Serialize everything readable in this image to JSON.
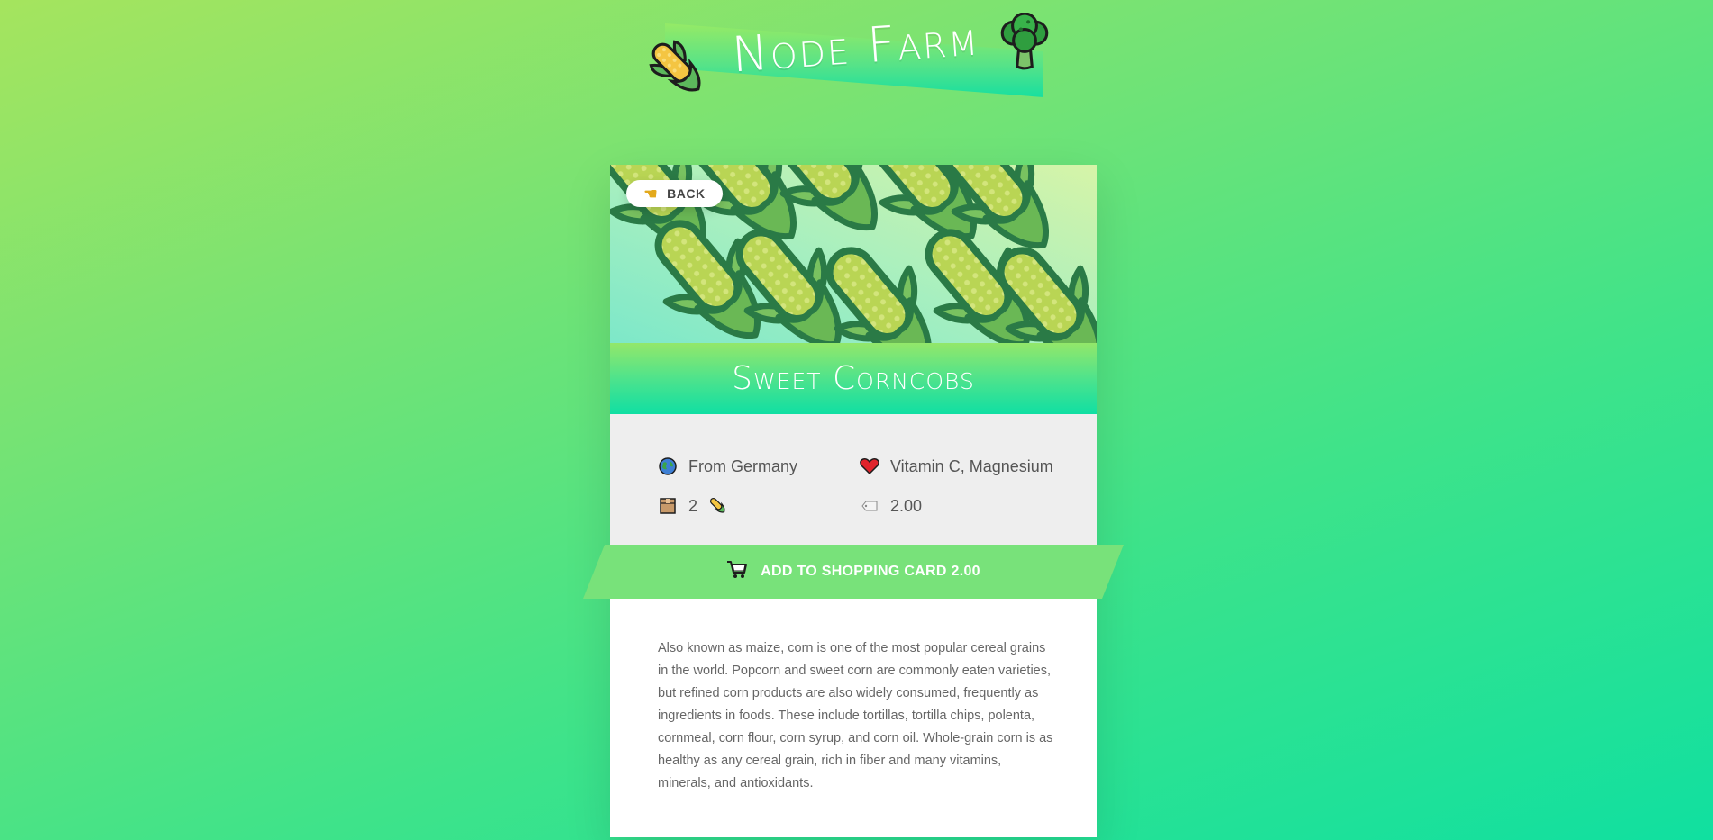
{
  "header": {
    "title": "Node Farm",
    "left_icon": "corn-icon",
    "right_icon": "broccoli-icon"
  },
  "product": {
    "back_label": "BACK",
    "back_icon": "pointing-hand-icon",
    "name": "Sweet Corncobs",
    "origin": "From Germany",
    "origin_icon": "globe-icon",
    "nutrients": "Vitamin C, Magnesium",
    "nutrients_icon": "heart-icon",
    "quantity": "2",
    "quantity_icon": "box-icon",
    "quantity_unit_icon": "corn-icon",
    "price": "2.00",
    "price_icon": "price-tag-icon",
    "add_to_cart_label": "ADD TO SHOPPING CARD 2.00",
    "cart_icon": "shopping-cart-icon",
    "description": "Also known as maize, corn is one of the most popular cereal grains in the world. Popcorn and sweet corn are commonly eaten varieties, but refined corn products are also widely consumed, frequently as ingredients in foods. These include tortillas, tortilla chips, polenta, cornmeal, corn flour, corn syrup, and corn oil. Whole-grain corn is as healthy as any cereal grain, rich in fiber and many vitamins, minerals, and antioxidants."
  },
  "colors": {
    "accent": "#78e27a",
    "title_band_top": "#93e76a",
    "title_band_bottom": "#10dfa3",
    "details_bg": "#eeeeee"
  }
}
